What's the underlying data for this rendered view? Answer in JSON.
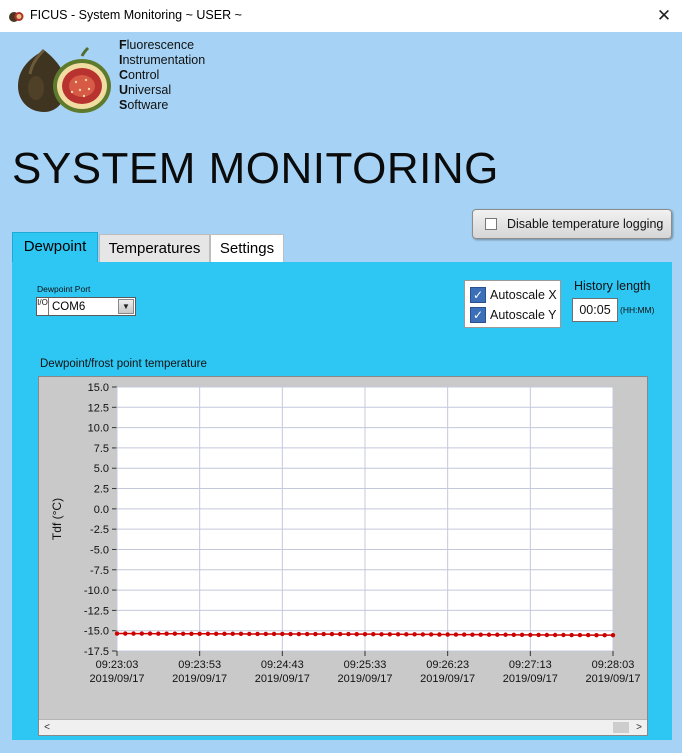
{
  "window": {
    "title": "FICUS - System Monitoring ~ USER ~",
    "close_glyph": "✕"
  },
  "logo": {
    "icon": "fig-logo",
    "acronym": [
      {
        "initial": "F",
        "rest": "luorescence"
      },
      {
        "initial": "I",
        "rest": "nstrumentation"
      },
      {
        "initial": "C",
        "rest": "ontrol"
      },
      {
        "initial": "U",
        "rest": "niversal"
      },
      {
        "initial": "S",
        "rest": "oftware"
      }
    ]
  },
  "header": {
    "title": "SYSTEM MONITORING"
  },
  "toolbar": {
    "disable_logging_label": "Disable temperature logging",
    "disable_logging_checked": false
  },
  "tabs": [
    {
      "label": "Dewpoint",
      "active": true
    },
    {
      "label": "Temperatures",
      "active": false
    },
    {
      "label": "Settings",
      "active": false
    }
  ],
  "dewpoint": {
    "port_label": "Dewpoint Port",
    "port_io_glyph": "I/O",
    "port_value": "COM6",
    "autoscale_x_label": "Autoscale X",
    "autoscale_x_checked": true,
    "autoscale_y_label": "Autoscale Y",
    "autoscale_y_checked": true,
    "history_label": "History length",
    "history_value": "00:05",
    "history_unit": "(HH:MM)",
    "chart_title": "Dewpoint/frost point temperature",
    "scroll_left": "<",
    "scroll_right": ">"
  },
  "colors": {
    "window_bg": "#a6d3f5",
    "panel_bg": "#2ec6f3",
    "series": "#cc0000",
    "plot_bg": "#ffffff"
  },
  "chart_data": {
    "type": "line",
    "title": "Dewpoint/frost point temperature",
    "xlabel": "",
    "ylabel": "Tdf (°C)",
    "ylim": [
      -17.5,
      15.0
    ],
    "yticks": [
      15.0,
      12.5,
      10.0,
      7.5,
      5.0,
      2.5,
      0.0,
      -2.5,
      -5.0,
      -7.5,
      -10.0,
      -12.5,
      -15.0,
      -17.5
    ],
    "ytick_labels": [
      "15.0",
      "12.5",
      "10.0",
      "7.5",
      "5.0",
      "2.5",
      "0.0",
      "-2.5",
      "-5.0",
      "-7.5",
      "-10.0",
      "-12.5",
      "-15.0",
      "-17.5"
    ],
    "xticks": [
      "09:23:03",
      "09:23:53",
      "09:24:43",
      "09:25:33",
      "09:26:23",
      "09:27:13",
      "09:28:03"
    ],
    "xtick_dates": [
      "2019/09/17",
      "2019/09/17",
      "2019/09/17",
      "2019/09/17",
      "2019/09/17",
      "2019/09/17",
      "2019/09/17"
    ],
    "grid": true,
    "series": [
      {
        "x_start": "09:23:03",
        "x_end": "09:28:03",
        "values": [
          -15.35,
          -15.35,
          -15.36,
          -15.36,
          -15.36,
          -15.37,
          -15.37,
          -15.37,
          -15.38,
          -15.38,
          -15.38,
          -15.38,
          -15.39,
          -15.39,
          -15.39,
          -15.39,
          -15.4,
          -15.4,
          -15.4,
          -15.4,
          -15.4,
          -15.41,
          -15.41,
          -15.41,
          -15.41,
          -15.42,
          -15.42,
          -15.42,
          -15.42,
          -15.43,
          -15.43,
          -15.43,
          -15.44,
          -15.44,
          -15.44,
          -15.45,
          -15.45,
          -15.46,
          -15.46,
          -15.47,
          -15.47,
          -15.48,
          -15.48,
          -15.49,
          -15.49,
          -15.5,
          -15.5,
          -15.5,
          -15.51,
          -15.51,
          -15.52,
          -15.52,
          -15.53,
          -15.53,
          -15.53,
          -15.54,
          -15.54,
          -15.54,
          -15.55,
          -15.55,
          -15.55
        ]
      }
    ]
  }
}
